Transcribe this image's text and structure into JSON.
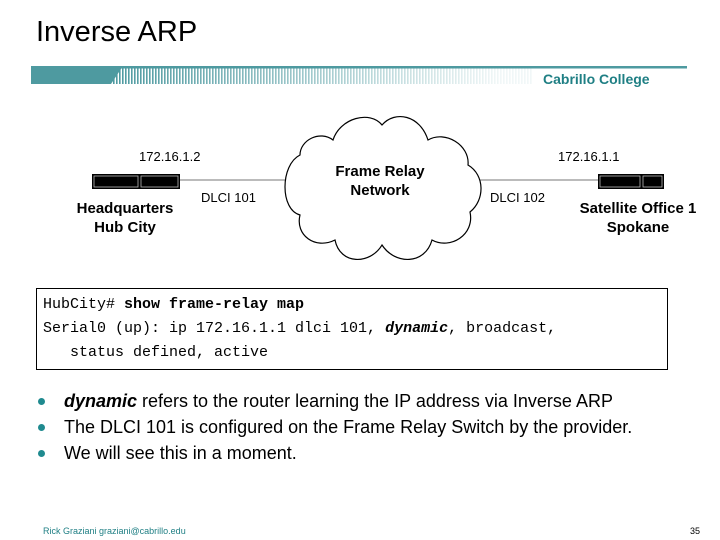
{
  "slide": {
    "title": "Inverse ARP",
    "college": "Cabrillo College",
    "accent_color": "#4e9aa0",
    "text_accent_color": "#1f7f84"
  },
  "diagram": {
    "cloud_label_line1": "Frame Relay",
    "cloud_label_line2": "Network",
    "left_router": {
      "ip": "172.16.1.2",
      "dlci": "DLCI 101",
      "name_line1": "Headquarters",
      "name_line2": "Hub City"
    },
    "right_router": {
      "ip": "172.16.1.1",
      "dlci": "DLCI 102",
      "name_line1": "Satellite Office 1",
      "name_line2": "Spokane"
    }
  },
  "code": {
    "prompt": "HubCity# ",
    "command": "show frame-relay map",
    "line2_pre": "Serial0 (up): ip 172.16.1.1 dlci 101, ",
    "line2_em": "dynamic",
    "line2_post": ", broadcast,",
    "line3": "   status defined, active"
  },
  "bullets": [
    {
      "em": "dynamic",
      "text": " refers to the router learning the IP address via Inverse ARP"
    },
    {
      "em": "",
      "text": "The DLCI 101 is configured on the Frame Relay Switch by the provider."
    },
    {
      "em": "",
      "text": "We will see this in a moment."
    }
  ],
  "footer": {
    "author": "Rick Graziani  graziani@cabrillo.edu",
    "page_number": "35"
  }
}
